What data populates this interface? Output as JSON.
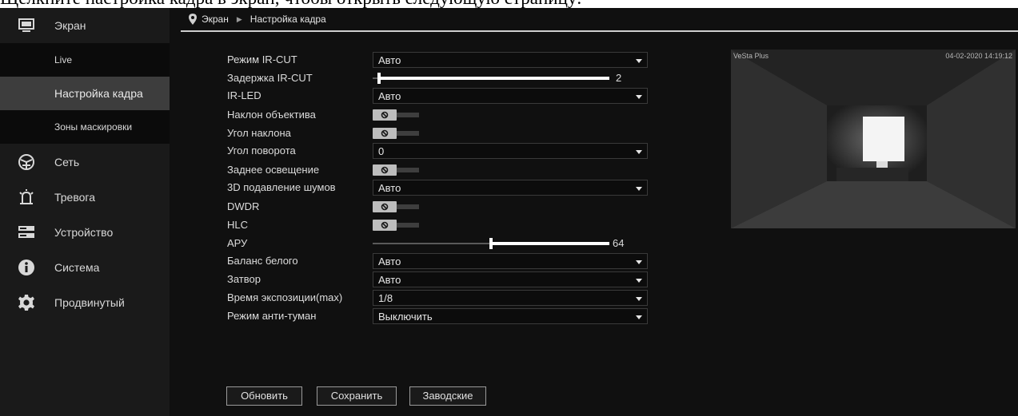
{
  "caption": "Щелкните настройка кадра в экран, чтобы открыть следующую страницу:",
  "sidebar": {
    "screen": {
      "label": "Экран",
      "icon": "monitor-icon"
    },
    "sub_items": [
      {
        "label": "Live"
      },
      {
        "label": "Настройка кадра",
        "active": true
      },
      {
        "label": "Зоны маскировки"
      }
    ],
    "items": [
      {
        "label": "Сеть",
        "icon": "network-icon"
      },
      {
        "label": "Тревога",
        "icon": "alarm-icon"
      },
      {
        "label": "Устройство",
        "icon": "device-icon"
      },
      {
        "label": "Система",
        "icon": "info-icon"
      },
      {
        "label": "Продвинутый",
        "icon": "gear-icon"
      }
    ]
  },
  "breadcrumb": {
    "root": "Экран",
    "current": "Настройка кадра"
  },
  "form": {
    "ircut_mode": {
      "label": "Режим IR-CUT",
      "value": "Авто"
    },
    "ircut_delay": {
      "label": "Задержка IR-CUT",
      "value": "2",
      "level": 0.02
    },
    "ir_led": {
      "label": "IR-LED",
      "value": "Авто"
    },
    "lens_tilt": {
      "label": "Наклон объектива",
      "state": "off"
    },
    "tilt_angle": {
      "label": "Угол наклона",
      "state": "off"
    },
    "rotation_angle": {
      "label": "Угол поворота",
      "value": "0"
    },
    "backlight": {
      "label": "Заднее освещение",
      "state": "off"
    },
    "noise_3d": {
      "label": "3D подавление шумов",
      "value": "Авто"
    },
    "dwdr": {
      "label": "DWDR",
      "state": "off"
    },
    "hlc": {
      "label": "HLC",
      "state": "off"
    },
    "agc": {
      "label": "АРУ",
      "value": "64",
      "level": 0.5
    },
    "white_balance": {
      "label": "Баланс белого",
      "value": "Авто"
    },
    "shutter": {
      "label": "Затвор",
      "value": "Авто"
    },
    "exposure_max": {
      "label": "Время экспозиции(max)",
      "value": "1/8"
    },
    "defog": {
      "label": "Режим анти-туман",
      "value": "Выключить"
    }
  },
  "buttons": {
    "refresh": "Обновить",
    "save": "Сохранить",
    "factory": "Заводские"
  },
  "preview": {
    "brand": "VeSta Plus",
    "timestamp": "04-02-2020 14:19:12"
  },
  "colors": {
    "background": "#101010",
    "sidebar": "#1a1a1a",
    "active_item": "#3d3d3d",
    "text": "#dcdcdc"
  }
}
